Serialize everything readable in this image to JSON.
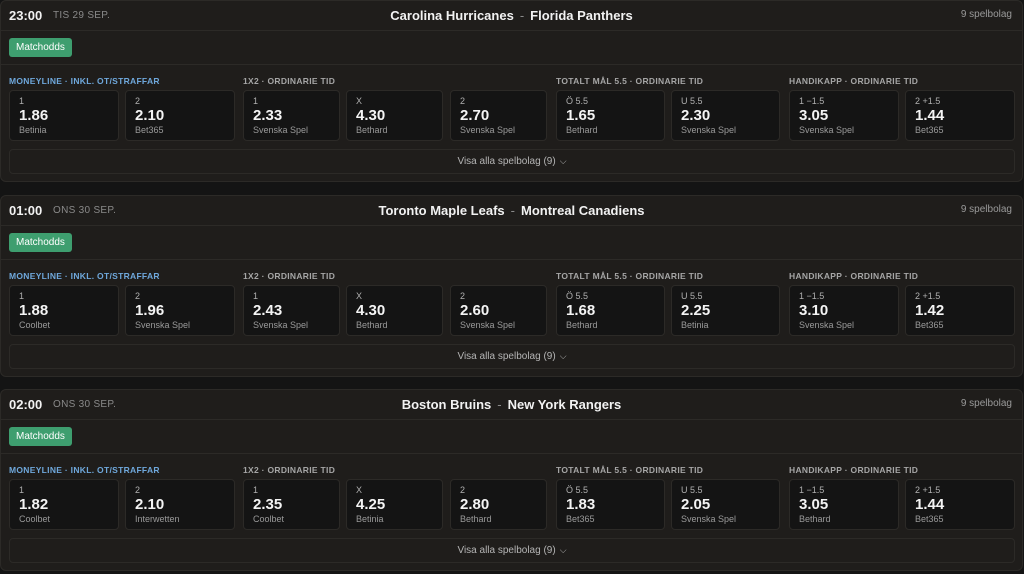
{
  "ui": {
    "tab_label": "Matchodds",
    "market_moneyline": "MONEYLINE · INKL. OT/STRAFFAR",
    "market_1x2": "1X2 · ORDINARIE TID",
    "market_total": "TOTALT MÅL 5.5 · ORDINARIE TID",
    "market_handicap": "HANDIKAPP · ORDINARIE TID",
    "chevron_icon": "chevron-down-icon"
  },
  "matches": [
    {
      "time": "23:00",
      "date": "TIS 29 SEP.",
      "home": "Carolina Hurricanes",
      "sep": "-",
      "away": "Florida Panthers",
      "bookies": "9 spelbolag",
      "odds": [
        {
          "label": "1",
          "value": "1.86",
          "bookie": "Betinia"
        },
        {
          "label": "2",
          "value": "2.10",
          "bookie": "Bet365"
        },
        {
          "label": "1",
          "value": "2.33",
          "bookie": "Svenska Spel"
        },
        {
          "label": "X",
          "value": "4.30",
          "bookie": "Bethard"
        },
        {
          "label": "2",
          "value": "2.70",
          "bookie": "Svenska Spel"
        },
        {
          "label": "Ö 5.5",
          "value": "1.65",
          "bookie": "Bethard"
        },
        {
          "label": "U 5.5",
          "value": "2.30",
          "bookie": "Svenska Spel"
        },
        {
          "label": "1 −1.5",
          "value": "3.05",
          "bookie": "Svenska Spel"
        },
        {
          "label": "2 +1.5",
          "value": "1.44",
          "bookie": "Bet365"
        }
      ],
      "show_all": "Visa alla spelbolag (9)"
    },
    {
      "time": "01:00",
      "date": "ONS 30 SEP.",
      "home": "Toronto Maple Leafs",
      "sep": "-",
      "away": "Montreal Canadiens",
      "bookies": "9 spelbolag",
      "odds": [
        {
          "label": "1",
          "value": "1.88",
          "bookie": "Coolbet"
        },
        {
          "label": "2",
          "value": "1.96",
          "bookie": "Svenska Spel"
        },
        {
          "label": "1",
          "value": "2.43",
          "bookie": "Svenska Spel"
        },
        {
          "label": "X",
          "value": "4.30",
          "bookie": "Bethard"
        },
        {
          "label": "2",
          "value": "2.60",
          "bookie": "Svenska Spel"
        },
        {
          "label": "Ö 5.5",
          "value": "1.68",
          "bookie": "Bethard"
        },
        {
          "label": "U 5.5",
          "value": "2.25",
          "bookie": "Betinia"
        },
        {
          "label": "1 −1.5",
          "value": "3.10",
          "bookie": "Svenska Spel"
        },
        {
          "label": "2 +1.5",
          "value": "1.42",
          "bookie": "Bet365"
        }
      ],
      "show_all": "Visa alla spelbolag (9)"
    },
    {
      "time": "02:00",
      "date": "ONS 30 SEP.",
      "home": "Boston Bruins",
      "sep": "-",
      "away": "New York Rangers",
      "bookies": "9 spelbolag",
      "odds": [
        {
          "label": "1",
          "value": "1.82",
          "bookie": "Coolbet"
        },
        {
          "label": "2",
          "value": "2.10",
          "bookie": "Interwetten"
        },
        {
          "label": "1",
          "value": "2.35",
          "bookie": "Coolbet"
        },
        {
          "label": "X",
          "value": "4.25",
          "bookie": "Betinia"
        },
        {
          "label": "2",
          "value": "2.80",
          "bookie": "Bethard"
        },
        {
          "label": "Ö 5.5",
          "value": "1.83",
          "bookie": "Bet365"
        },
        {
          "label": "U 5.5",
          "value": "2.05",
          "bookie": "Svenska Spel"
        },
        {
          "label": "1 −1.5",
          "value": "3.05",
          "bookie": "Bethard"
        },
        {
          "label": "2 +1.5",
          "value": "1.44",
          "bookie": "Bet365"
        }
      ],
      "show_all": "Visa alla spelbolag (9)"
    }
  ]
}
